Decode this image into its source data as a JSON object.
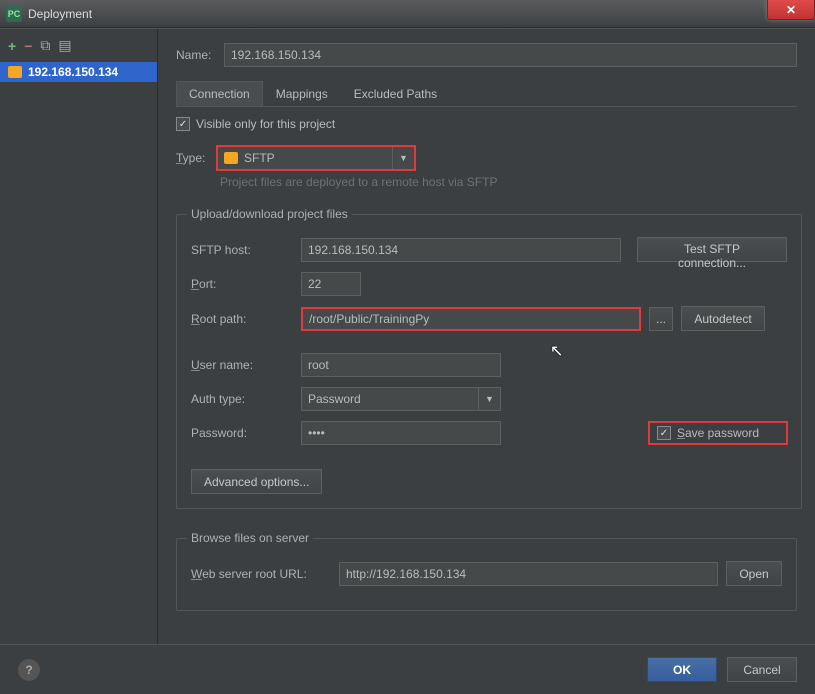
{
  "window": {
    "title": "Deployment"
  },
  "sidebar": {
    "server": "192.168.150.134"
  },
  "name": {
    "label": "Name:",
    "value": "192.168.150.134"
  },
  "tabs": {
    "connection": "Connection",
    "mappings": "Mappings",
    "excluded": "Excluded Paths"
  },
  "visible_only": "Visible only for this project",
  "type": {
    "label": "Type:",
    "value": "SFTP",
    "hint": "Project files are deployed to a remote host via SFTP"
  },
  "upload_group": "Upload/download project files",
  "sftp_host": {
    "label": "SFTP host:",
    "value": "192.168.150.134",
    "test_btn": "Test SFTP connection..."
  },
  "port": {
    "label": "Port:",
    "value": "22"
  },
  "root_path": {
    "label": "Root path:",
    "value": "/root/Public/TrainingPy",
    "dots": "...",
    "autodetect": "Autodetect"
  },
  "user": {
    "label": "User name:",
    "value": "root"
  },
  "auth": {
    "label": "Auth type:",
    "value": "Password"
  },
  "password": {
    "label": "Password:",
    "value": "••••",
    "save": "Save password"
  },
  "advanced": "Advanced options...",
  "browse_group": "Browse files on server",
  "web_url": {
    "label": "Web server root URL:",
    "value": "http://192.168.150.134",
    "open": "Open"
  },
  "footer": {
    "ok": "OK",
    "cancel": "Cancel"
  }
}
